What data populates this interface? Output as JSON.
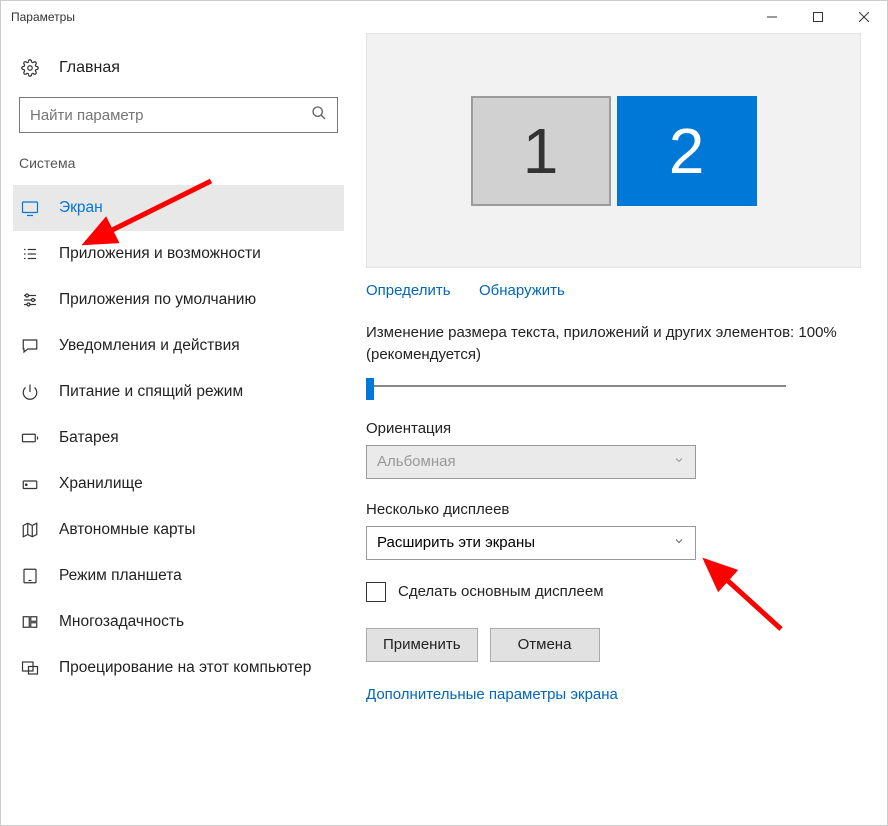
{
  "window": {
    "title": "Параметры"
  },
  "sidebar": {
    "home": "Главная",
    "search_placeholder": "Найти параметр",
    "group": "Система",
    "items": [
      {
        "label": "Экран"
      },
      {
        "label": "Приложения и возможности"
      },
      {
        "label": "Приложения по умолчанию"
      },
      {
        "label": "Уведомления и действия"
      },
      {
        "label": "Питание и спящий режим"
      },
      {
        "label": "Батарея"
      },
      {
        "label": "Хранилище"
      },
      {
        "label": "Автономные карты"
      },
      {
        "label": "Режим планшета"
      },
      {
        "label": "Многозадачность"
      },
      {
        "label": "Проецирование на этот компьютер"
      }
    ]
  },
  "main": {
    "monitors": {
      "m1": "1",
      "m2": "2"
    },
    "identify": "Определить",
    "detect": "Обнаружить",
    "scale_text": "Изменение размера текста, приложений и других элементов: 100% (рекомендуется)",
    "orientation_label": "Ориентация",
    "orientation_value": "Альбомная",
    "multi_label": "Несколько дисплеев",
    "multi_value": "Расширить эти экраны",
    "main_display_chk": "Сделать основным дисплеем",
    "apply": "Применить",
    "cancel": "Отмена",
    "advanced": "Дополнительные параметры экрана"
  }
}
